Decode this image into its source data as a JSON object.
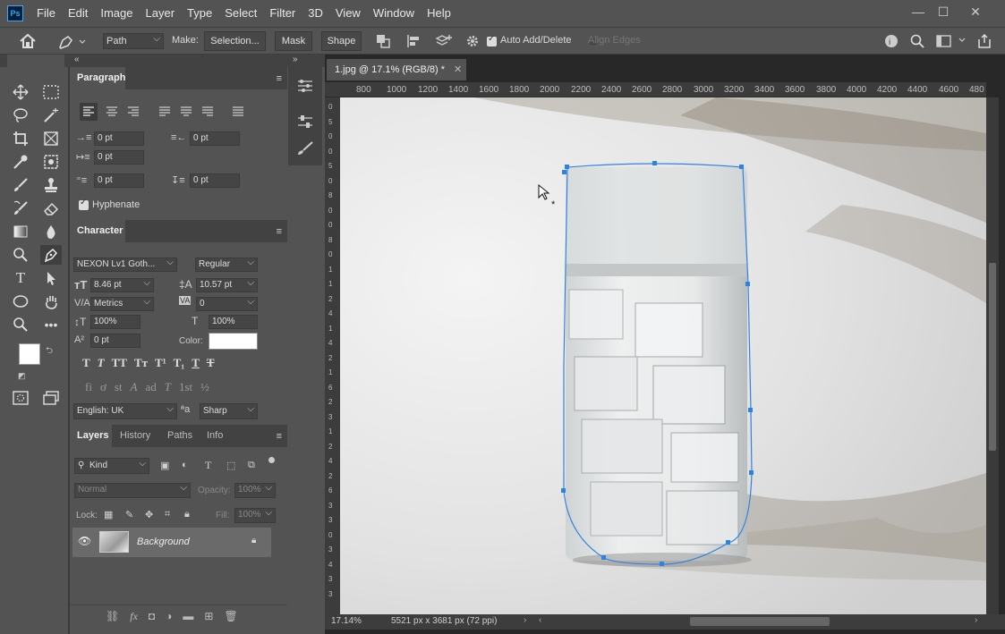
{
  "app": {
    "logo": "Ps"
  },
  "menu": [
    "File",
    "Edit",
    "Image",
    "Layer",
    "Type",
    "Select",
    "Filter",
    "3D",
    "View",
    "Window",
    "Help"
  ],
  "window_controls": {
    "minimize": "—",
    "maximize": "☐",
    "close": "✕"
  },
  "options": {
    "mode": "Path",
    "make_label": "Make:",
    "selection_btn": "Selection...",
    "mask_btn": "Mask",
    "shape_btn": "Shape",
    "auto_add_delete": "Auto Add/Delete",
    "auto_add_checked": true,
    "align_edges": "Align Edges",
    "align_edges_checked": false
  },
  "paragraph": {
    "tab": "Paragraph",
    "indent_left": "0 pt",
    "indent_right": "0 pt",
    "indent_first": "0 pt",
    "space_before": "0 pt",
    "space_after": "0 pt",
    "hyphenate": "Hyphenate",
    "hyphenate_checked": true
  },
  "character": {
    "tab": "Character",
    "font_family": "NEXON Lv1 Goth...",
    "font_style": "Regular",
    "font_size": "8.46 pt",
    "leading": "10.57 pt",
    "kerning": "Metrics",
    "tracking": "0",
    "vertical_scale": "100%",
    "horizontal_scale": "100%",
    "baseline_shift": "0 pt",
    "color_label": "Color:",
    "color_value": "#ffffff",
    "language": "English: UK",
    "aa_label": "ªa",
    "antialias": "Sharp",
    "style_buttons": [
      "T",
      "T",
      "TT",
      "Tт",
      "T¹",
      "T₁",
      "T",
      "T"
    ],
    "opentype_buttons": [
      "fi",
      "ơ",
      "st",
      "A",
      "ad",
      "T",
      "1st",
      "½"
    ]
  },
  "layers": {
    "tabs": [
      "Layers",
      "History",
      "Paths",
      "Info"
    ],
    "active_tab": "Layers",
    "filter_kind": "Kind",
    "blend_mode": "Normal",
    "opacity_label": "Opacity:",
    "opacity": "100%",
    "lock_label": "Lock:",
    "fill_label": "Fill:",
    "fill": "100%",
    "items": [
      {
        "name": "Background",
        "visible": true,
        "locked": true
      }
    ]
  },
  "document": {
    "tab_title": "1.jpg @ 17.1% (RGB/8) *",
    "zoom": "17.14%",
    "dimensions": "5521 px x 3681 px (72 ppi)"
  },
  "ruler_top": [
    "800",
    "1000",
    "1200",
    "1400",
    "1600",
    "1800",
    "2000",
    "2200",
    "2400",
    "2600",
    "2800",
    "3000",
    "3200",
    "3400",
    "3600",
    "3800",
    "4000",
    "4200",
    "4400",
    "4600",
    "480"
  ],
  "ruler_left": [
    "0",
    "5",
    "0",
    "0",
    "5",
    "0",
    "8",
    "0",
    "0",
    "8",
    "0",
    "1",
    "1",
    "2",
    "4",
    "1",
    "4",
    "2",
    "1",
    "6",
    "2",
    "3",
    "1",
    "2",
    "4",
    "2",
    "6",
    "3",
    "3",
    "0",
    "3",
    "4",
    "3",
    "3"
  ],
  "colors": {
    "accent": "#2f83e0",
    "foreground": "#ffffff",
    "background": "#000000",
    "app_bg": "#535353"
  }
}
